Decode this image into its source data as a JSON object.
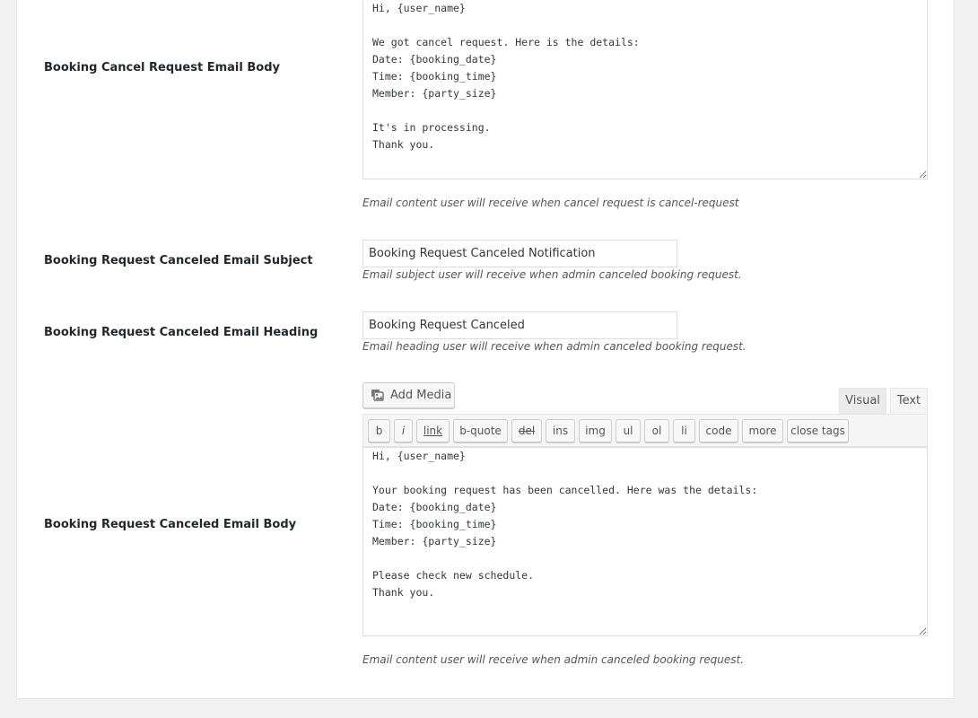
{
  "fields": {
    "cancel_request_body": {
      "label": "Booking Cancel Request Email Body",
      "value": "Hi, {user_name}\n\nWe got cancel request. Here is the details:\nDate: {booking_date}\nTime: {booking_time}\nMember: {party_size}\n\nIt's in processing.\nThank you.",
      "description": "Email content user will receive when cancel request is cancel-request"
    },
    "canceled_subject": {
      "label": "Booking Request Canceled Email Subject",
      "value": "Booking Request Canceled Notification",
      "description": "Email subject user will receive when admin canceled booking request."
    },
    "canceled_heading": {
      "label": "Booking Request Canceled Email Heading",
      "value": "Booking Request Canceled",
      "description": "Email heading user will receive when admin canceled booking request."
    },
    "canceled_body": {
      "label": "Booking Request Canceled Email Body",
      "value": "Hi, {user_name}\n\nYour booking request has been cancelled. Here was the details:\nDate: {booking_date}\nTime: {booking_time}\nMember: {party_size}\n\nPlease check new schedule.\nThank you.",
      "description": "Email content user will receive when admin canceled booking request."
    }
  },
  "editor": {
    "add_media_label": "Add Media",
    "add_media_icon": "media-icon",
    "tabs": {
      "visual": "Visual",
      "text": "Text",
      "active": "text"
    },
    "quicktags": [
      "b",
      "i",
      "link",
      "b-quote",
      "del",
      "ins",
      "img",
      "ul",
      "ol",
      "li",
      "code",
      "more",
      "close tags"
    ]
  }
}
